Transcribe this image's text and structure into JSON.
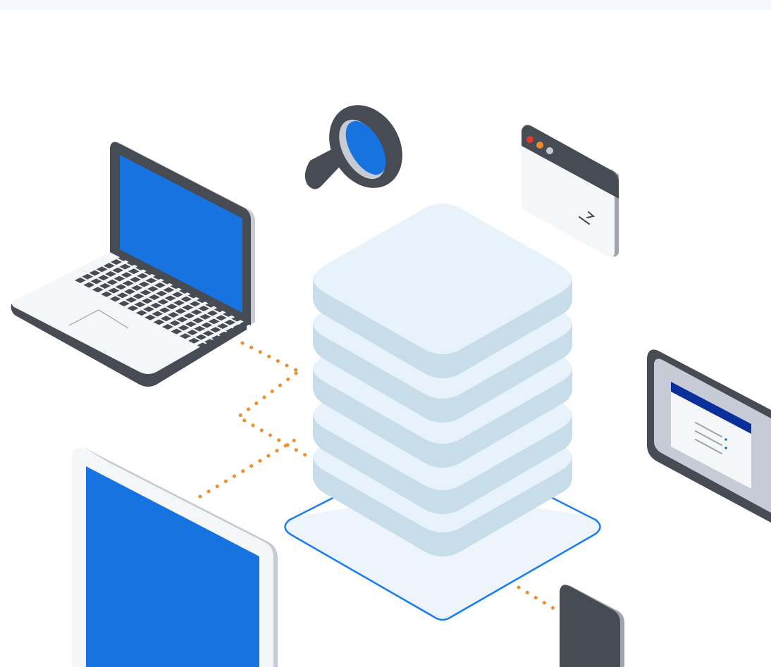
{
  "illustration": {
    "colors": {
      "top_band": "#f3f7fb",
      "screen_blue": "#1673df",
      "dark_body": "#474b53",
      "light_body": "#f5f6f7",
      "mid_gray": "#c7cbd6",
      "rim_gray": "#9ea4ad",
      "stack_top": "#e8f2fa",
      "stack_side": "#c7dde9",
      "platform_fill": "#eef4fb",
      "platform_outline": "#1a7de9",
      "connector_orange": "#ef8e2e",
      "navy_bar": "#0b2f9a",
      "dot_red": "#e23a2e",
      "dot_orange": "#f08a26",
      "dot_gray": "#c9ccd3"
    },
    "icons": [
      "laptop-icon",
      "magnifier-icon",
      "browser-window-icon",
      "database-stack-icon",
      "tablet-icon",
      "desktop-monitor-icon",
      "phone-icon"
    ]
  }
}
